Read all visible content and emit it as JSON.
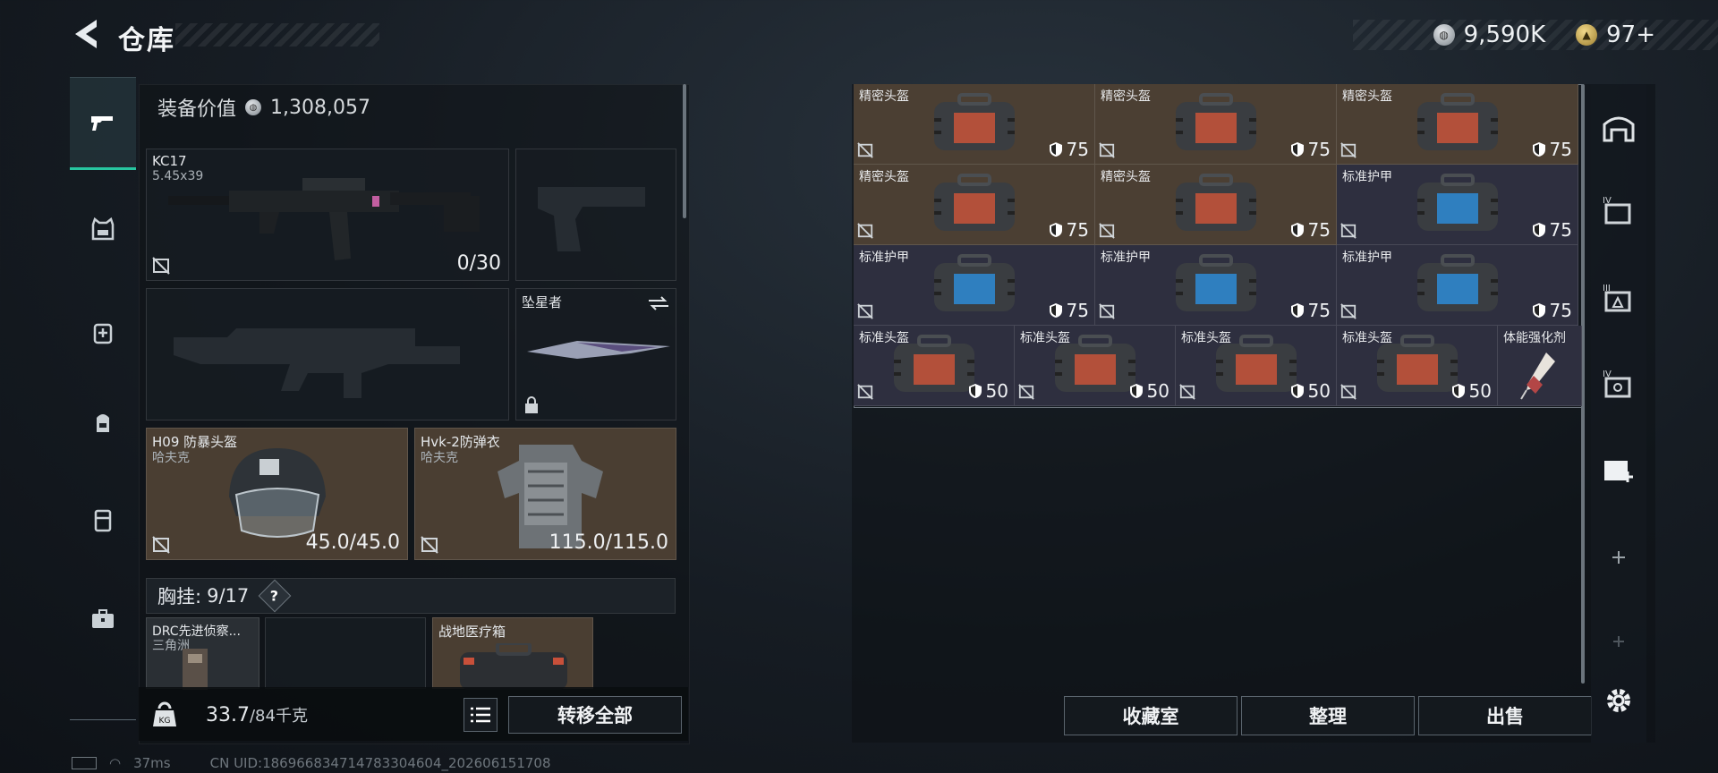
{
  "header": {
    "title": "仓库"
  },
  "currency": {
    "silver": "9,590K",
    "gold": "97+"
  },
  "equipment": {
    "value_label": "装备价值",
    "value": "1,308,057",
    "primary": {
      "name": "KC17",
      "caliber": "5.45x39",
      "ammo": "0/30"
    },
    "melee": {
      "name": "坠星者"
    },
    "helmet": {
      "name": "H09 防暴头盔",
      "brand": "哈夫克",
      "durability": "45.0/45.0"
    },
    "armor": {
      "name": "Hvk-2防弹衣",
      "brand": "哈夫克",
      "durability": "115.0/115.0"
    },
    "chest_rig": {
      "label": "胸挂:",
      "capacity": "9/17",
      "help": "?"
    },
    "rig_items": [
      {
        "name": "DRC先进侦察...",
        "brand": "三角洲"
      },
      {
        "name": ""
      },
      {
        "name": "战地医疗箱"
      }
    ],
    "weight": {
      "current": "33.7",
      "max": "/84千克"
    },
    "transfer_all": "转移全部"
  },
  "stash": {
    "row1": [
      {
        "name": "精密头盔",
        "durability": "75"
      },
      {
        "name": "精密头盔",
        "durability": "75"
      },
      {
        "name": "精密头盔",
        "durability": "75"
      }
    ],
    "row2": [
      {
        "name": "精密头盔",
        "durability": "75"
      },
      {
        "name": "精密头盔",
        "durability": "75"
      },
      {
        "name": "标准护甲",
        "durability": "75"
      }
    ],
    "row3": [
      {
        "name": "标准护甲",
        "durability": "75"
      },
      {
        "name": "标准护甲",
        "durability": "75"
      },
      {
        "name": "标准护甲",
        "durability": "75"
      }
    ],
    "row4": [
      {
        "name": "标准头盔",
        "durability": "50"
      },
      {
        "name": "标准头盔",
        "durability": "50"
      },
      {
        "name": "标准头盔",
        "durability": "50"
      },
      {
        "name": "标准头盔",
        "durability": "50"
      },
      {
        "name": "体能强化剂"
      }
    ]
  },
  "actions": {
    "collection": "收藏室",
    "organize": "整理",
    "sell": "出售"
  },
  "status": {
    "ping": "37ms",
    "uid": "CN UID:18696683471478330460​4_202606151708"
  }
}
